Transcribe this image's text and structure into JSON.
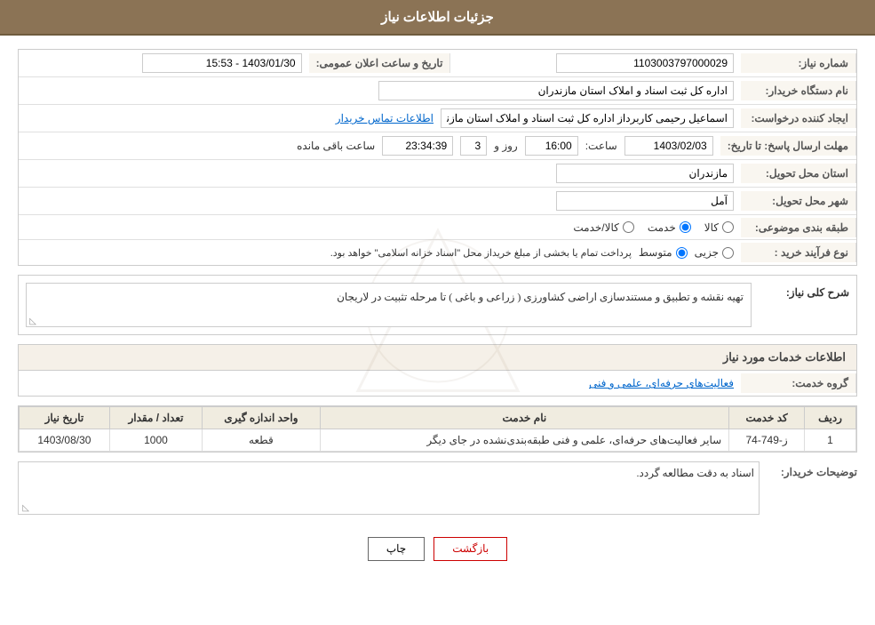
{
  "header": {
    "title": "جزئیات اطلاعات نیاز"
  },
  "fields": {
    "need_number_label": "شماره نیاز:",
    "need_number_value": "1103003797000029",
    "date_label": "تاریخ و ساعت اعلان عمومی:",
    "date_value": "1403/01/30 - 15:53",
    "buyer_name_label": "نام دستگاه خریدار:",
    "buyer_name_value": "اداره کل ثبت اسناد و املاک استان مازندران",
    "creator_label": "ایجاد کننده درخواست:",
    "creator_value": "اسماعیل رحیمی کاربرداز اداره کل ثبت اسناد و املاک استان مازندران",
    "contact_link": "اطلاعات تماس خریدار",
    "response_deadline_label": "مهلت ارسال پاسخ: تا تاریخ:",
    "response_date": "1403/02/03",
    "response_time_label": "ساعت:",
    "response_time": "16:00",
    "remaining_days_label": "روز و",
    "remaining_days": "3",
    "remaining_time_label": "ساعت باقی مانده",
    "remaining_time": "23:34:39",
    "province_label": "استان محل تحویل:",
    "province_value": "مازندران",
    "city_label": "شهر محل تحویل:",
    "city_value": "آمل",
    "category_label": "طبقه بندی موضوعی:",
    "category_radio1": "کالا",
    "category_radio2": "خدمت",
    "category_radio3": "کالا/خدمت",
    "purchase_type_label": "نوع فرآیند خرید :",
    "purchase_type_radio1": "جزیی",
    "purchase_type_radio2": "متوسط",
    "purchase_type_note": "پرداخت تمام یا بخشی از مبلغ خریداز محل \"اسناد خزانه اسلامی\" خواهد بود.",
    "description_label": "شرح کلی نیاز:",
    "description_value": "تهیه نقشه و تطبیق و مستندسازی اراضی کشاورزی ( زراعی و باغی ) تا مرحله تثبیت در لاریجان"
  },
  "service_info": {
    "section_title": "اطلاعات خدمات مورد نیاز",
    "service_group_label": "گروه خدمت:",
    "service_group_value": "فعالیت‌های حرفه‌ای، علمی و فنی",
    "table": {
      "columns": [
        "ردیف",
        "کد خدمت",
        "نام خدمت",
        "واحد اندازه گیری",
        "تعداد / مقدار",
        "تاریخ نیاز"
      ],
      "rows": [
        {
          "row_num": "1",
          "code": "ز-749-74",
          "name": "سایر فعالیت‌های حرفه‌ای، علمی و فنی طبقه‌بندی‌نشده در جای دیگر",
          "unit": "قطعه",
          "quantity": "1000",
          "date": "1403/08/30"
        }
      ]
    }
  },
  "buyer_notes": {
    "label": "توضیحات خریدار:",
    "value": "اسناد به دقت مطالعه گردد."
  },
  "buttons": {
    "print": "چاپ",
    "back": "بازگشت"
  }
}
